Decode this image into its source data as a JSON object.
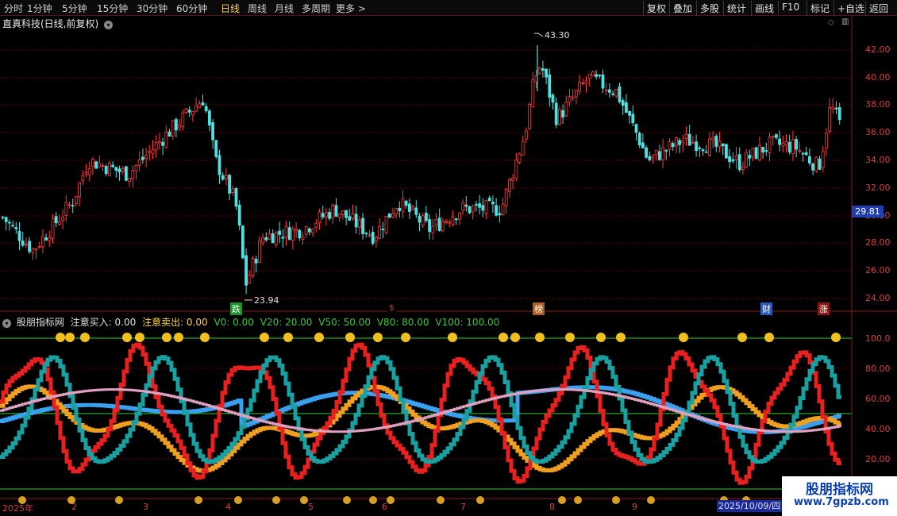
{
  "toolbar": {
    "periods": [
      "分时",
      "1分钟",
      "5分钟",
      "15分钟",
      "30分钟",
      "60分钟",
      "日线",
      "周线",
      "月线",
      "多周期",
      "更多 >"
    ],
    "active_index": 6,
    "right_buttons": [
      "复权",
      "叠加",
      "多股",
      "统计",
      "画线",
      "F10",
      "标记",
      "+自选",
      "返回"
    ]
  },
  "stock": {
    "title": "直真科技(日线,前复权)",
    "current_price": "29.81",
    "high_label": "43.30",
    "low_label": "23.94"
  },
  "main_axis": {
    "ticks": [
      "42.00",
      "40.00",
      "38.00",
      "36.00",
      "34.00",
      "32.00",
      "30.00",
      "28.00",
      "26.00",
      "24.00"
    ]
  },
  "markers": [
    {
      "text": "跌",
      "color": "#1f8f2f"
    },
    {
      "text": "$",
      "color": "#c01818"
    },
    {
      "text": "榜",
      "color": "#b06020"
    },
    {
      "text": "财",
      "color": "#2a5ab8"
    },
    {
      "text": "涨",
      "color": "#c01818"
    }
  ],
  "indicator": {
    "name": "股朋指标网",
    "buy_label": "注意买入: 0.00",
    "sell_label": "注意卖出: 0.00",
    "levels": [
      "V0: 0.00",
      "V20: 20.00",
      "V50: 50.00",
      "V80: 80.00",
      "V100: 100.00"
    ],
    "axis_ticks": [
      "100.0",
      "80.00",
      "60.00",
      "40.00",
      "20.00"
    ]
  },
  "x_axis": {
    "labels": [
      "2025年",
      "2",
      "3",
      "4",
      "5",
      "6",
      "7",
      "8",
      "9"
    ],
    "date": "2025/10/09/四"
  },
  "watermark": {
    "title": "股朋指标网",
    "url": "www.7gpzb.com"
  },
  "colors": {
    "up": "#ff3a3a",
    "down": "#50e0e0",
    "grid": "#7a1010",
    "accent": "#ffd24a"
  }
}
